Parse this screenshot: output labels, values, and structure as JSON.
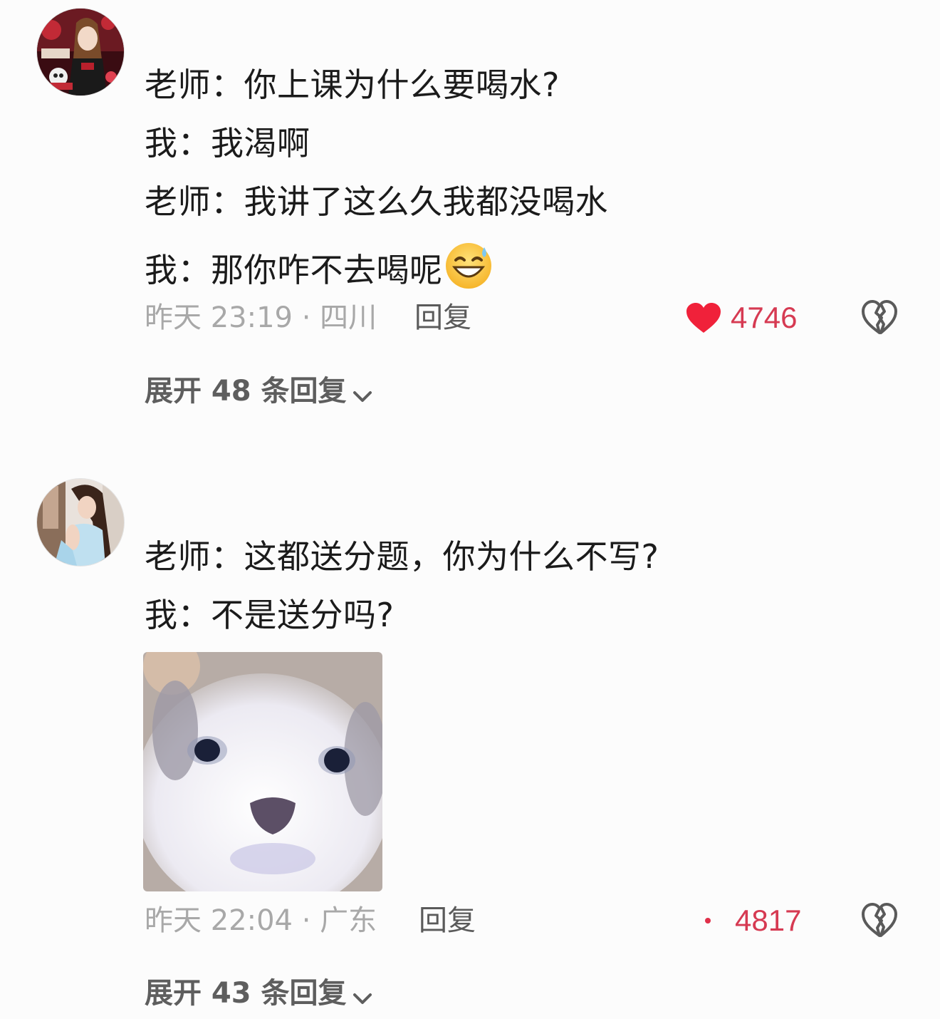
{
  "comments": [
    {
      "avatar": "anime-girl-avatar",
      "lines": [
        "老师：你上课为什么要喝水?",
        "我：我渴啊",
        "老师：我讲了这么久我都没喝水",
        "我：那你咋不去喝呢"
      ],
      "emoji": "grinning-sweat-emoji",
      "time_location": "昨天 23:19 · 四川",
      "reply_label": "回复",
      "like_count": "4746",
      "like_icon": "heart-filled-icon",
      "dislike_icon": "broken-heart-icon",
      "expand_label": "展开 48 条回复",
      "expand_icon": "chevron-down-icon"
    },
    {
      "avatar": "woman-photo-avatar",
      "lines": [
        "老师：这都送分题，你为什么不写?",
        "我：不是送分吗?"
      ],
      "sticker": "puppy-sticker",
      "time_location": "昨天 22:04 · 广东",
      "reply_label": "回复",
      "like_count": "4817",
      "like_icon": "heart-dot-icon",
      "dislike_icon": "broken-heart-icon",
      "expand_label": "展开 43 条回复",
      "expand_icon": "chevron-down-icon"
    }
  ],
  "colors": {
    "background": "#fcfcfc",
    "text": "#1b1b1b",
    "meta": "#a8a8a8",
    "accent": "#d63a52"
  }
}
